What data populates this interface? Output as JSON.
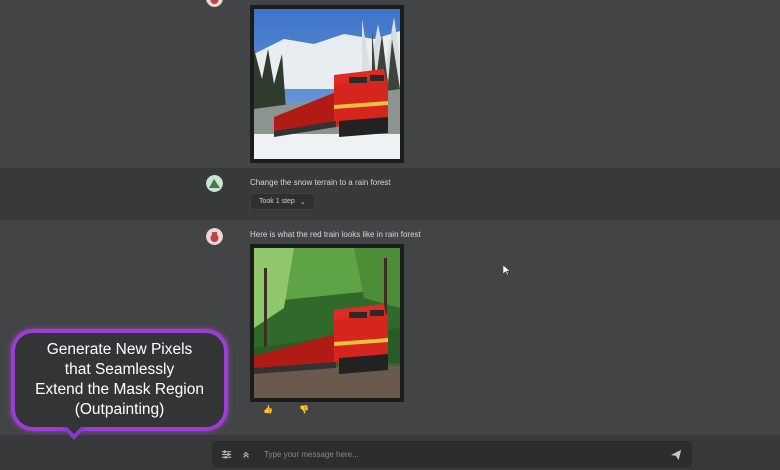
{
  "chat": {
    "user_message": "Change the snow terrain to a rain forest",
    "steps_label": "Took 1 step",
    "assistant_message": "Here is what the red train looks like in rain forest"
  },
  "input": {
    "placeholder": "Type your message here..."
  },
  "callout": {
    "text": "Generate New Pixels\nthat Seamlessly\nExtend the Mask Region\n(Outpainting)"
  },
  "icons": {
    "user_avatar": "tree-avatar-icon",
    "assistant_avatar": "bot-avatar-icon",
    "thumbs_up": "thumbs-up-icon",
    "thumbs_down": "thumbs-down-icon",
    "settings": "sliders-icon",
    "expand": "chevrons-up-icon",
    "send": "send-icon"
  },
  "colors": {
    "callout_border": "#9c3bd6",
    "train_red": "#d6251d"
  }
}
